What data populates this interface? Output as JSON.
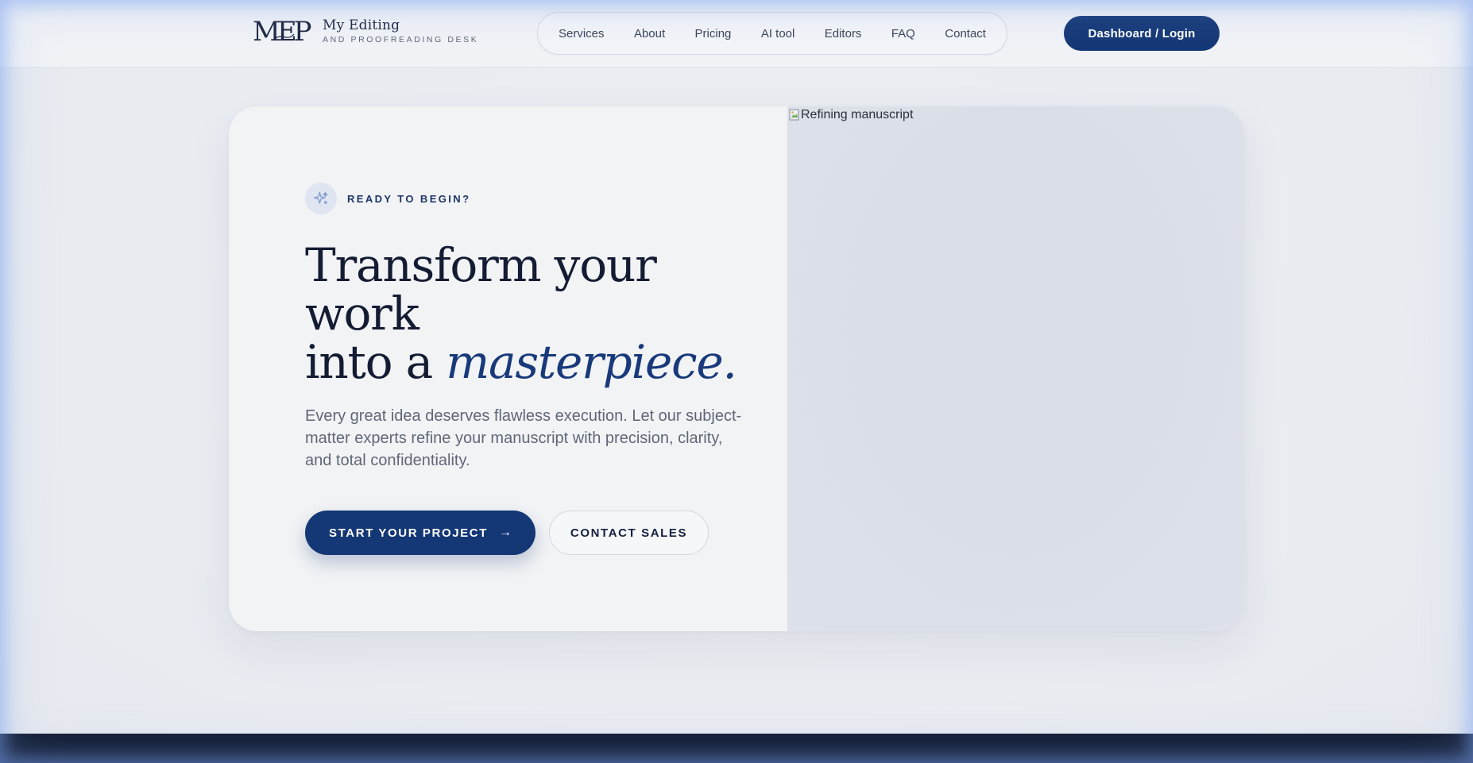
{
  "header": {
    "logo": {
      "mark": "MEP",
      "title": "My Editing",
      "subtitle": "AND PROOFREADING DESK"
    },
    "nav": [
      {
        "label": "Services"
      },
      {
        "label": "About"
      },
      {
        "label": "Pricing"
      },
      {
        "label": "AI tool"
      },
      {
        "label": "Editors"
      },
      {
        "label": "FAQ"
      },
      {
        "label": "Contact"
      }
    ],
    "login_label": "Dashboard / Login"
  },
  "hero": {
    "badge": {
      "icon": "sparkles-icon",
      "label": "READY TO BEGIN?"
    },
    "headline": {
      "line1": "Transform your work",
      "line2_prefix": "into a ",
      "accent": "masterpiece."
    },
    "description": "Every great idea deserves flawless execution. Let our subject-matter experts refine your manuscript with precision, clarity, and total confidentiality.",
    "primary_cta": {
      "label": "START YOUR PROJECT",
      "icon": "arrow-right-icon",
      "glyph": "→"
    },
    "secondary_cta": {
      "label": "CONTACT SALES"
    },
    "image": {
      "alt": "Refining manuscript",
      "icon": "broken-image-icon"
    }
  },
  "colors": {
    "brand_navy": "#143775",
    "accent_text": "#18397a",
    "headline_text": "#141c33",
    "footer": "#101a31"
  }
}
